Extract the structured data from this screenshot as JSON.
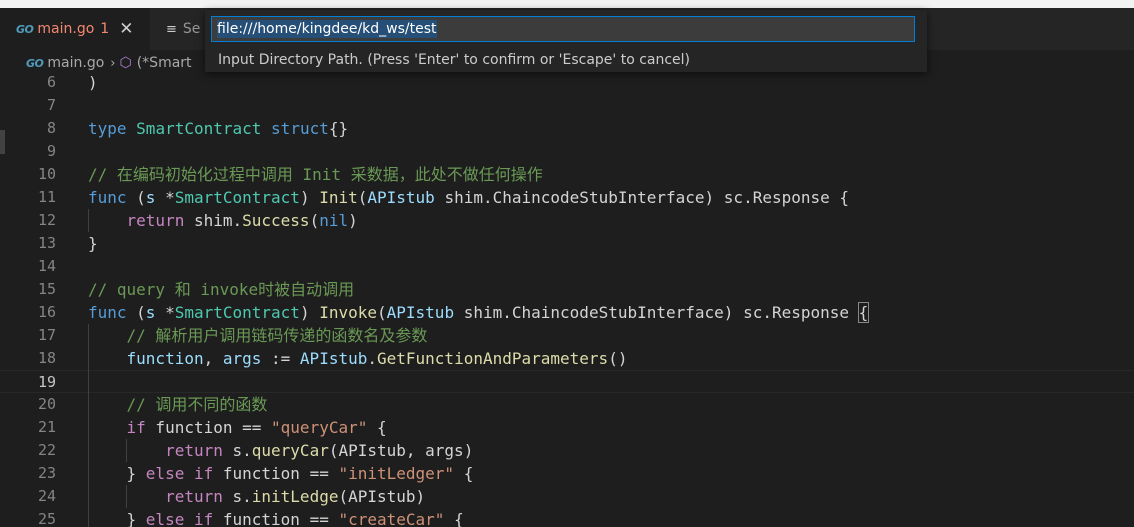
{
  "tabs": [
    {
      "icon": "go-file-icon",
      "icon_text": "GO",
      "title": "main.go",
      "problem_count": "1",
      "close": "✕"
    },
    {
      "icon": "file-list-icon",
      "icon_text": "≡",
      "title": "Se"
    }
  ],
  "breadcrumb": {
    "file_icon_text": "GO",
    "file": "main.go",
    "separator": "›",
    "symbol_icon": "cube-icon",
    "symbol": "(*Smart"
  },
  "quick_input": {
    "value": "file:///home/kingdee/kd_ws/test",
    "message": "Input Directory Path. (Press 'Enter' to confirm or 'Escape' to cancel)"
  },
  "editor": {
    "lines": [
      {
        "n": "6",
        "t": [
          {
            "c": "plain",
            "s": ")"
          }
        ]
      },
      {
        "n": "7",
        "t": []
      },
      {
        "n": "8",
        "t": [
          {
            "c": "keyword",
            "s": "type"
          },
          {
            "c": "plain",
            "s": " "
          },
          {
            "c": "type",
            "s": "SmartContract"
          },
          {
            "c": "plain",
            "s": " "
          },
          {
            "c": "keyword",
            "s": "struct"
          },
          {
            "c": "plain",
            "s": "{}"
          }
        ]
      },
      {
        "n": "9",
        "t": []
      },
      {
        "n": "10",
        "t": [
          {
            "c": "comment",
            "s": "// 在编码初始化过程中调用 Init 采数据，此处不做任何操作"
          }
        ]
      },
      {
        "n": "11",
        "t": [
          {
            "c": "keyword",
            "s": "func"
          },
          {
            "c": "plain",
            "s": " ("
          },
          {
            "c": "var",
            "s": "s"
          },
          {
            "c": "plain",
            "s": " *"
          },
          {
            "c": "type",
            "s": "SmartContract"
          },
          {
            "c": "plain",
            "s": ") "
          },
          {
            "c": "func",
            "s": "Init"
          },
          {
            "c": "plain",
            "s": "("
          },
          {
            "c": "var",
            "s": "APIstub"
          },
          {
            "c": "plain",
            "s": " shim.ChaincodeStubInterface) sc.Response {"
          }
        ]
      },
      {
        "n": "12",
        "t": [
          {
            "c": "plain",
            "s": "    "
          },
          {
            "c": "control",
            "s": "return"
          },
          {
            "c": "plain",
            "s": " shim."
          },
          {
            "c": "func",
            "s": "Success"
          },
          {
            "c": "plain",
            "s": "("
          },
          {
            "c": "keyword",
            "s": "nil"
          },
          {
            "c": "plain",
            "s": ")"
          }
        ]
      },
      {
        "n": "13",
        "t": [
          {
            "c": "plain",
            "s": "}"
          }
        ]
      },
      {
        "n": "14",
        "t": []
      },
      {
        "n": "15",
        "t": [
          {
            "c": "comment",
            "s": "// query 和 invoke时被自动调用"
          }
        ]
      },
      {
        "n": "16",
        "t": [
          {
            "c": "keyword",
            "s": "func"
          },
          {
            "c": "plain",
            "s": " ("
          },
          {
            "c": "var",
            "s": "s"
          },
          {
            "c": "plain",
            "s": " *"
          },
          {
            "c": "type",
            "s": "SmartContract"
          },
          {
            "c": "plain",
            "s": ") "
          },
          {
            "c": "func",
            "s": "Invoke"
          },
          {
            "c": "plain",
            "s": "("
          },
          {
            "c": "var",
            "s": "APIstub"
          },
          {
            "c": "plain",
            "s": " shim.ChaincodeStubInterface) sc.Response "
          },
          {
            "c": "bracket",
            "s": "{"
          }
        ]
      },
      {
        "n": "17",
        "t": [
          {
            "c": "plain",
            "s": "    "
          },
          {
            "c": "comment",
            "s": "// 解析用户调用链码传递的函数名及参数"
          }
        ]
      },
      {
        "n": "18",
        "t": [
          {
            "c": "plain",
            "s": "    "
          },
          {
            "c": "var",
            "s": "function"
          },
          {
            "c": "plain",
            "s": ", "
          },
          {
            "c": "var",
            "s": "args"
          },
          {
            "c": "plain",
            "s": " := "
          },
          {
            "c": "var",
            "s": "APIstub"
          },
          {
            "c": "plain",
            "s": "."
          },
          {
            "c": "func",
            "s": "GetFunctionAndParameters"
          },
          {
            "c": "plain",
            "s": "()"
          }
        ]
      },
      {
        "n": "19",
        "t": [],
        "current": true
      },
      {
        "n": "20",
        "t": [
          {
            "c": "plain",
            "s": "    "
          },
          {
            "c": "comment",
            "s": "// 调用不同的函数"
          }
        ]
      },
      {
        "n": "21",
        "t": [
          {
            "c": "plain",
            "s": "    "
          },
          {
            "c": "control",
            "s": "if"
          },
          {
            "c": "plain",
            "s": " function == "
          },
          {
            "c": "string",
            "s": "\"queryCar\""
          },
          {
            "c": "plain",
            "s": " {"
          }
        ]
      },
      {
        "n": "22",
        "t": [
          {
            "c": "plain",
            "s": "        "
          },
          {
            "c": "control",
            "s": "return"
          },
          {
            "c": "plain",
            "s": " s."
          },
          {
            "c": "func",
            "s": "queryCar"
          },
          {
            "c": "plain",
            "s": "(APIstub, args)"
          }
        ]
      },
      {
        "n": "23",
        "t": [
          {
            "c": "plain",
            "s": "    } "
          },
          {
            "c": "control",
            "s": "else"
          },
          {
            "c": "plain",
            "s": " "
          },
          {
            "c": "control",
            "s": "if"
          },
          {
            "c": "plain",
            "s": " function == "
          },
          {
            "c": "string",
            "s": "\"initLedger\""
          },
          {
            "c": "plain",
            "s": " {"
          }
        ]
      },
      {
        "n": "24",
        "t": [
          {
            "c": "plain",
            "s": "        "
          },
          {
            "c": "control",
            "s": "return"
          },
          {
            "c": "plain",
            "s": " s."
          },
          {
            "c": "func",
            "s": "initLedge"
          },
          {
            "c": "plain",
            "s": "(APIstub)"
          }
        ]
      },
      {
        "n": "25",
        "t": [
          {
            "c": "plain",
            "s": "    } "
          },
          {
            "c": "control",
            "s": "else"
          },
          {
            "c": "plain",
            "s": " "
          },
          {
            "c": "control",
            "s": "if"
          },
          {
            "c": "plain",
            "s": " function == "
          },
          {
            "c": "string",
            "s": "\"createCar\""
          },
          {
            "c": "plain",
            "s": " {"
          }
        ]
      }
    ]
  }
}
